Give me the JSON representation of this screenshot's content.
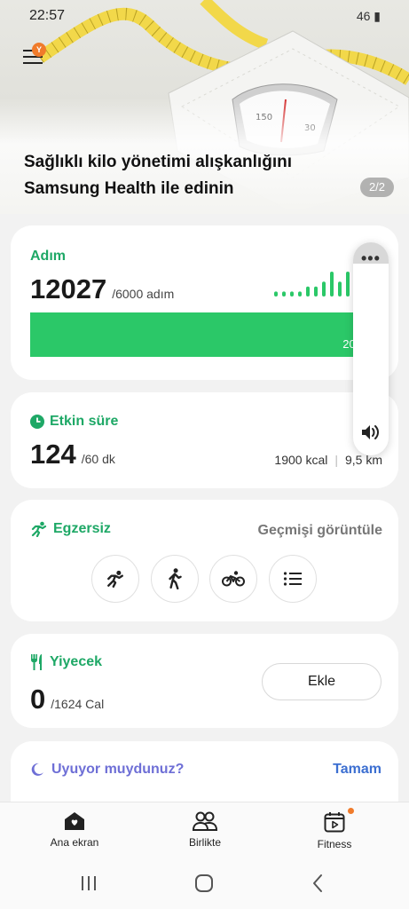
{
  "status_bar": {
    "time": "22:57",
    "right": "46"
  },
  "hero": {
    "title": "Sağlıklı kilo yönetimi alışkanlığını Samsung Health ile edinin",
    "pager": "2/2",
    "menu_badge": "Y"
  },
  "steps": {
    "label": "Adım",
    "value": "12027",
    "goal": "/6000 adım",
    "bar_label": "200",
    "progress": 1.0,
    "spark_values": [
      1,
      1,
      1,
      1,
      2,
      2,
      3,
      5,
      3,
      5,
      5
    ]
  },
  "active_time": {
    "label": "Etkin süre",
    "value": "124",
    "goal": "/60 dk",
    "kcal": "1900 kcal",
    "distance": "9,5 km"
  },
  "exercise": {
    "label": "Egzersiz",
    "history_link": "Geçmişi görüntüle",
    "buttons": [
      "running-icon",
      "walking-icon",
      "cycling-icon",
      "list-icon"
    ]
  },
  "food": {
    "label": "Yiyecek",
    "value": "0",
    "goal": "/1624 Cal",
    "add_button": "Ekle"
  },
  "sleep": {
    "label": "Uyuyor muydunuz?",
    "done_link": "Tamam"
  },
  "bottom_nav": {
    "items": [
      {
        "label": "Ana ekran",
        "icon": "home-icon"
      },
      {
        "label": "Birlikte",
        "icon": "people-icon"
      },
      {
        "label": "Fitness",
        "icon": "fitness-icon"
      }
    ]
  },
  "colors": {
    "accent_green": "#1ea866",
    "bar_green": "#2bc868",
    "sleep_purple": "#6e6fd6",
    "link_blue": "#3c6fd1",
    "badge_orange": "#f07b2b"
  }
}
